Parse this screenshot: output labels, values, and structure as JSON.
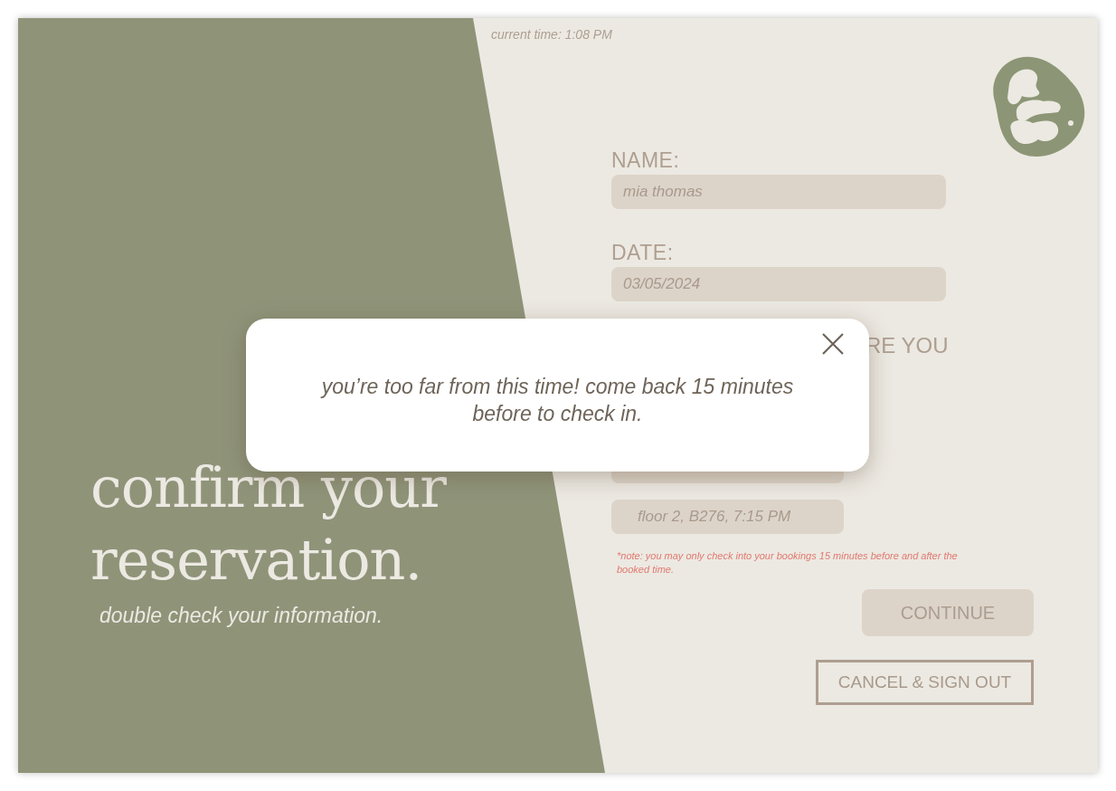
{
  "status": {
    "current_time": "current time: 1:08 PM"
  },
  "hero": {
    "title_lines": [
      "confirm your",
      "reservation."
    ],
    "subtitle": "double check your information."
  },
  "form": {
    "fields": [
      {
        "label": "NAME:",
        "value": "mia thomas"
      },
      {
        "label": "DATE:",
        "value": "03/05/2024"
      }
    ],
    "bookings_heading": "RE YOU",
    "bookings": [
      {
        "kind": "hidden"
      },
      {
        "kind": "option",
        "value": "floor 2, B276, 7:15 PM"
      }
    ],
    "note": "*note: you may only check into your bookings 15 minutes before and after the booked time."
  },
  "continue_button": {
    "label": "CONTINUE",
    "disabled": true
  },
  "cancel_button": {
    "label": "CANCEL & SIGN OUT"
  },
  "modal": {
    "message": "you’re too far from this time! come back 15 minutes before to check in."
  }
}
